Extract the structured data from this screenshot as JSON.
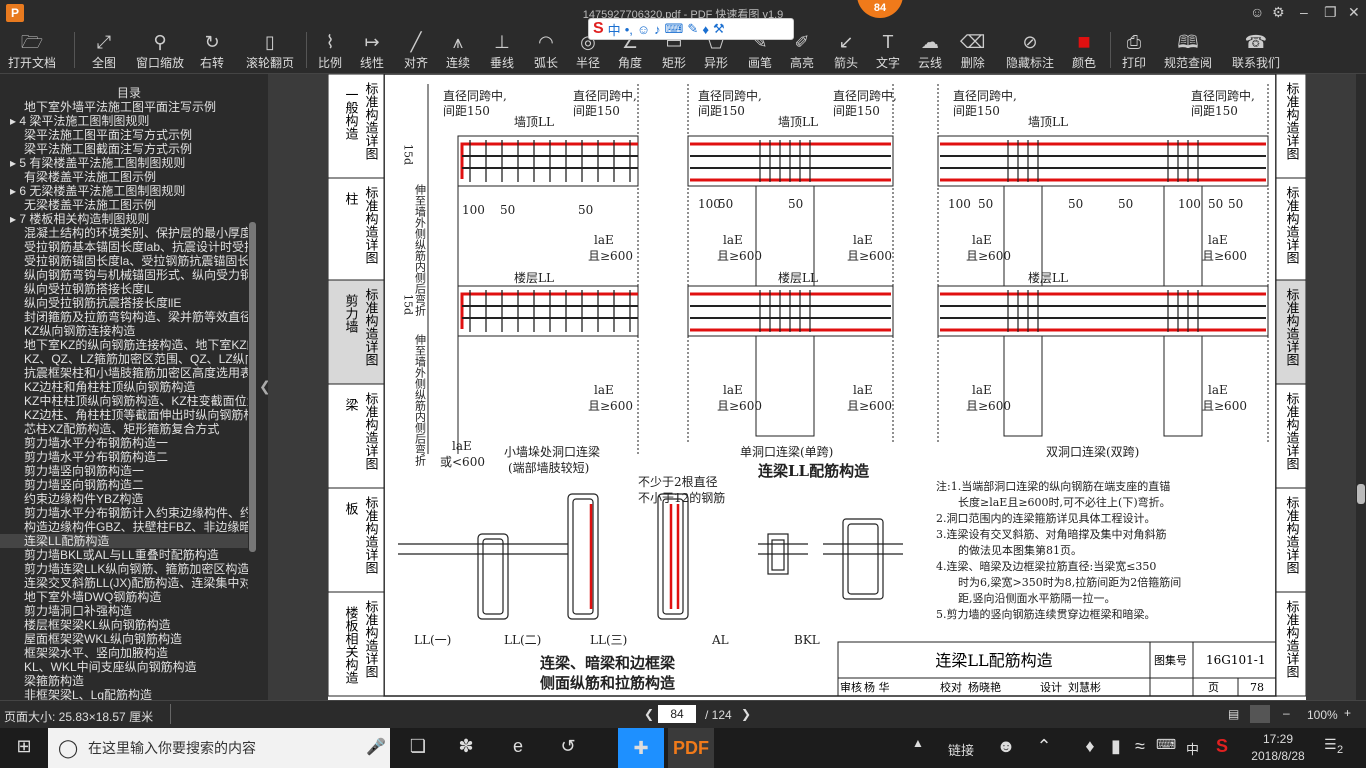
{
  "titlebar": {
    "title": "1475927706320.pdf - PDF 快速看图 v1.9",
    "page_badge": "84",
    "logo": "P"
  },
  "ime": {
    "label": "中"
  },
  "toolbar": [
    {
      "label": "打开文档",
      "icon": "folder-icon"
    },
    {
      "label": "全图",
      "icon": "fit-icon"
    },
    {
      "label": "窗口缩放",
      "icon": "zoom-icon"
    },
    {
      "label": "右转",
      "icon": "rotate-icon"
    },
    {
      "label": "滚轮翻页",
      "icon": "mouse-icon"
    },
    {
      "label": "比例",
      "icon": "scale-icon"
    },
    {
      "label": "线性",
      "icon": "linear-icon"
    },
    {
      "label": "对齐",
      "icon": "align-icon"
    },
    {
      "label": "连续",
      "icon": "continuous-icon"
    },
    {
      "label": "垂线",
      "icon": "perpendicular-icon"
    },
    {
      "label": "弧长",
      "icon": "arc-icon"
    },
    {
      "label": "半径",
      "icon": "radius-icon"
    },
    {
      "label": "角度",
      "icon": "angle-icon"
    },
    {
      "label": "矩形",
      "icon": "rect-icon"
    },
    {
      "label": "异形",
      "icon": "polygon-icon"
    },
    {
      "label": "画笔",
      "icon": "pen-icon"
    },
    {
      "label": "高亮",
      "icon": "highlight-icon"
    },
    {
      "label": "箭头",
      "icon": "arrow-icon"
    },
    {
      "label": "文字",
      "icon": "text-icon"
    },
    {
      "label": "云线",
      "icon": "cloud-icon"
    },
    {
      "label": "删除",
      "icon": "eraser-icon"
    },
    {
      "label": "隐藏标注",
      "icon": "hide-icon"
    },
    {
      "label": "颜色",
      "icon": "color-icon"
    },
    {
      "label": "打印",
      "icon": "print-icon"
    },
    {
      "label": "规范查阅",
      "icon": "book-icon"
    },
    {
      "label": "联系我们",
      "icon": "contact-icon"
    }
  ],
  "sidebar": {
    "title": "目录",
    "items": [
      {
        "t": "地下室外墙平法施工图平面注写示例",
        "lv": 1
      },
      {
        "t": "4 梁平法施工图制图规则",
        "lv": 0
      },
      {
        "t": "梁平法施工图平面注写方式示例",
        "lv": 1
      },
      {
        "t": "梁平法施工图截面注写方式示例",
        "lv": 1
      },
      {
        "t": "5 有梁楼盖平法施工图制图规则",
        "lv": 0
      },
      {
        "t": "有梁楼盖平法施工图示例",
        "lv": 1
      },
      {
        "t": "6 无梁楼盖平法施工图制图规则",
        "lv": 0
      },
      {
        "t": "无梁楼盖平法施工图示例",
        "lv": 1
      },
      {
        "t": "7 楼板相关构造制图规则",
        "lv": 0
      },
      {
        "t": "混凝土结构的环境类别、保护层的最小厚度",
        "lv": 1
      },
      {
        "t": "受拉钢筋基本锚固长度lab、抗震设计时受拉",
        "lv": 1
      },
      {
        "t": "受拉钢筋锚固长度la、受拉钢筋抗震锚固长",
        "lv": 1
      },
      {
        "t": "纵向钢筋弯钩与机械锚固形式、纵向受力钢",
        "lv": 1
      },
      {
        "t": "纵向受拉钢筋搭接长度lL",
        "lv": 1
      },
      {
        "t": "纵向受拉钢筋抗震搭接长度llE",
        "lv": 1
      },
      {
        "t": "封闭箍筋及拉筋弯钩构造、梁并筋等效直径",
        "lv": 1
      },
      {
        "t": "KZ纵向钢筋连接构造",
        "lv": 1
      },
      {
        "t": "地下室KZ的纵向钢筋连接构造、地下室KZ的",
        "lv": 1
      },
      {
        "t": "KZ、QZ、LZ箍筋加密区范围、QZ、LZ纵向钢",
        "lv": 1
      },
      {
        "t": "抗震框架柱和小墙肢箍筋加密区高度选用表",
        "lv": 1
      },
      {
        "t": "KZ边柱和角柱柱顶纵向钢筋构造",
        "lv": 1
      },
      {
        "t": "KZ中柱柱顶纵向钢筋构造、KZ柱变截面位置",
        "lv": 1
      },
      {
        "t": "KZ边柱、角柱柱顶等截面伸出时纵向钢筋构",
        "lv": 1
      },
      {
        "t": "芯柱XZ配筋构造、矩形箍筋复合方式",
        "lv": 1
      },
      {
        "t": "剪力墙水平分布钢筋构造一",
        "lv": 1
      },
      {
        "t": "剪力墙水平分布钢筋构造二",
        "lv": 1
      },
      {
        "t": "剪力墙竖向钢筋构造一",
        "lv": 1
      },
      {
        "t": "剪力墙竖向钢筋构造二",
        "lv": 1
      },
      {
        "t": "约束边缘构件YBZ构造",
        "lv": 1
      },
      {
        "t": "剪力墙水平分布钢筋计入约束边缘构件、约",
        "lv": 1
      },
      {
        "t": "构造边缘构件GBZ、扶壁柱FBZ、非边缘暗柱",
        "lv": 1
      },
      {
        "t": "连梁LL配筋构造",
        "lv": 1,
        "sel": true
      },
      {
        "t": "剪力墙BKL或AL与LL重叠时配筋构造",
        "lv": 1
      },
      {
        "t": "剪力墙连梁LLK纵向钢筋、箍筋加密区构造",
        "lv": 1
      },
      {
        "t": "连梁交叉斜筋LL(JX)配筋构造、连梁集中对",
        "lv": 1
      },
      {
        "t": "地下室外墙DWQ钢筋构造",
        "lv": 1
      },
      {
        "t": "剪力墙洞口补强构造",
        "lv": 1
      },
      {
        "t": "楼层框架梁KL纵向钢筋构造",
        "lv": 1
      },
      {
        "t": "屋面框架梁WKL纵向钢筋构造",
        "lv": 1
      },
      {
        "t": "框架梁水平、竖向加腋构造",
        "lv": 1
      },
      {
        "t": "KL、WKL中间支座纵向钢筋构造",
        "lv": 1
      },
      {
        "t": "梁箍筋构造",
        "lv": 1
      },
      {
        "t": "非框架梁L、Lg配筋构造",
        "lv": 1
      }
    ]
  },
  "page": {
    "left_tabs": [
      "标准构造详图",
      "标准构造详图",
      "标准构造详图",
      "标准构造详图",
      "标准构造详图",
      "标准构造详图"
    ],
    "left_cats": [
      "一般构造",
      "柱",
      "剪力墙",
      "梁",
      "板",
      "楼板相关构造"
    ],
    "right_tabs": [
      "标准构造详图",
      "标准构造详图",
      "标准构造详图",
      "标准构造详图",
      "标准构造详图",
      "标准构造详图"
    ],
    "labels": {
      "dia": "直径同跨中,",
      "spacing": "间距150",
      "top_ll": "墙顶LL",
      "floor_ll": "楼层LL",
      "d15": "15d",
      "ext": "伸至墙外侧纵筋内侧后弯折",
      "n100": "100",
      "n50": "50",
      "lae": "laE",
      "ge600": "且≥600",
      "or600": "或<600",
      "cap1": "小墙垛处洞口连梁",
      "cap1b": "(端部墙肢较短)",
      "cap2": "单洞口连梁(单跨)",
      "cap3": "双洞口连梁(双跨)",
      "main_title": "连梁LL配筋构造",
      "sec_note1": "不少于2根直径",
      "sec_note2": "不小于12的钢筋",
      "sec1": "LL(一)",
      "sec2": "LL(二)",
      "sec3": "LL(三)",
      "sec4": "AL",
      "sec5": "BKL",
      "sec_title1": "连梁、暗梁和边框梁",
      "sec_title2": "侧面纵筋和拉筋构造"
    },
    "notes": [
      "注:1.当端部洞口连梁的纵向钢筋在端支座的直锚",
      "长度≥laE且≥600时,可不必往上(下)弯折。",
      "2.洞口范围内的连梁箍筋详见具体工程设计。",
      "3.连梁设有交叉斜筋、对角暗撑及集中对角斜筋",
      "的做法见本图集第81页。",
      "4.连梁、暗梁及边框梁拉筋直径:当梁宽≤350",
      "时为6,梁宽>350时为8,拉筋间距为2倍箍筋间",
      "距,竖向沿侧面水平筋隔一拉一。",
      "5.剪力墙的竖向钢筋连续贯穿边框梁和暗梁。"
    ],
    "titleblock": {
      "title": "连梁LL配筋构造",
      "atlas_label": "图集号",
      "atlas": "16G101-1",
      "review": "审核",
      "reviewer": "杨 华",
      "check": "校对",
      "checker": "杨晓艳",
      "design": "设计",
      "designer": "刘慧彬",
      "page_label": "页",
      "page": "78"
    }
  },
  "status": {
    "page_size": "页面大小: 25.83×18.57 厘米",
    "current_page": "84",
    "total": "/ 124",
    "zoom": "100%"
  },
  "taskbar": {
    "search_placeholder": "在这里输入你要搜索的内容",
    "link": "链接",
    "ime": "中",
    "time": "17:29",
    "date": "2018/8/28",
    "notif": "2"
  }
}
